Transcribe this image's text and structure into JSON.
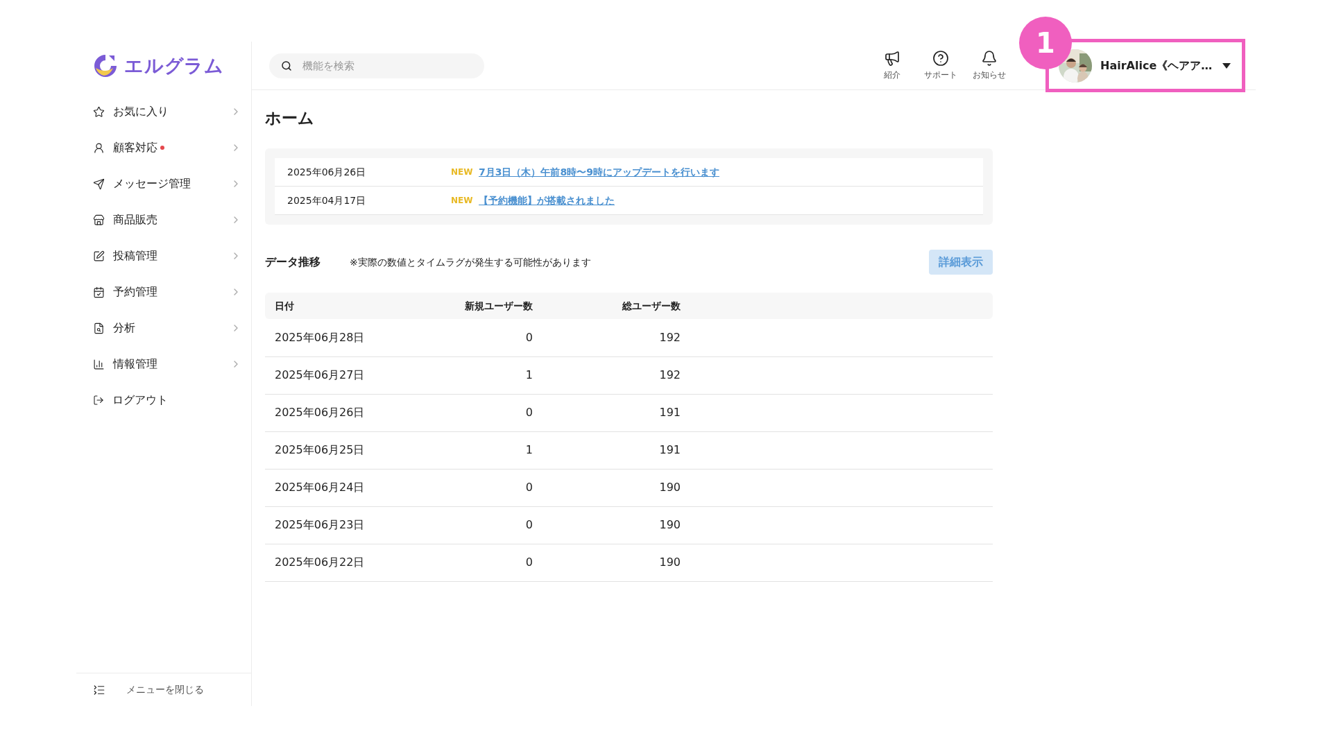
{
  "logo": {
    "text": "エルグラム"
  },
  "sidebar": {
    "items": [
      {
        "label": "お気に入り",
        "badge": false
      },
      {
        "label": "顧客対応",
        "badge": true
      },
      {
        "label": "メッセージ管理",
        "badge": false
      },
      {
        "label": "商品販売",
        "badge": false
      },
      {
        "label": "投稿管理",
        "badge": false
      },
      {
        "label": "予約管理",
        "badge": false
      },
      {
        "label": "分析",
        "badge": false
      },
      {
        "label": "情報管理",
        "badge": false
      }
    ],
    "logout": "ログアウト",
    "close_menu": "メニューを閉じる"
  },
  "header": {
    "search": {
      "placeholder": "機能を検索"
    },
    "actions": [
      "紹介",
      "サポート",
      "お知らせ"
    ],
    "user": {
      "name": "HairAlice《ヘアア…"
    },
    "annotation": "1"
  },
  "page_title": "ホーム",
  "news": [
    {
      "date": "2025年06月26日",
      "tag": "NEW",
      "title": "7月3日（木）午前8時〜9時にアップデートを行います"
    },
    {
      "date": "2025年04月17日",
      "tag": "NEW",
      "title": "【予約機能】が搭載されました"
    }
  ],
  "data_section": {
    "title": "データ推移",
    "note": "※実際の数値とタイムラグが発生する可能性があります",
    "button": "詳細表示"
  },
  "table": {
    "columns": [
      "日付",
      "新規ユーザー数",
      "総ユーザー数"
    ],
    "rows": [
      [
        "2025年06月28日",
        "0",
        "192"
      ],
      [
        "2025年06月27日",
        "1",
        "192"
      ],
      [
        "2025年06月26日",
        "0",
        "191"
      ],
      [
        "2025年06月25日",
        "1",
        "191"
      ],
      [
        "2025年06月24日",
        "0",
        "190"
      ],
      [
        "2025年06月23日",
        "0",
        "190"
      ],
      [
        "2025年06月22日",
        "0",
        "190"
      ]
    ]
  }
}
